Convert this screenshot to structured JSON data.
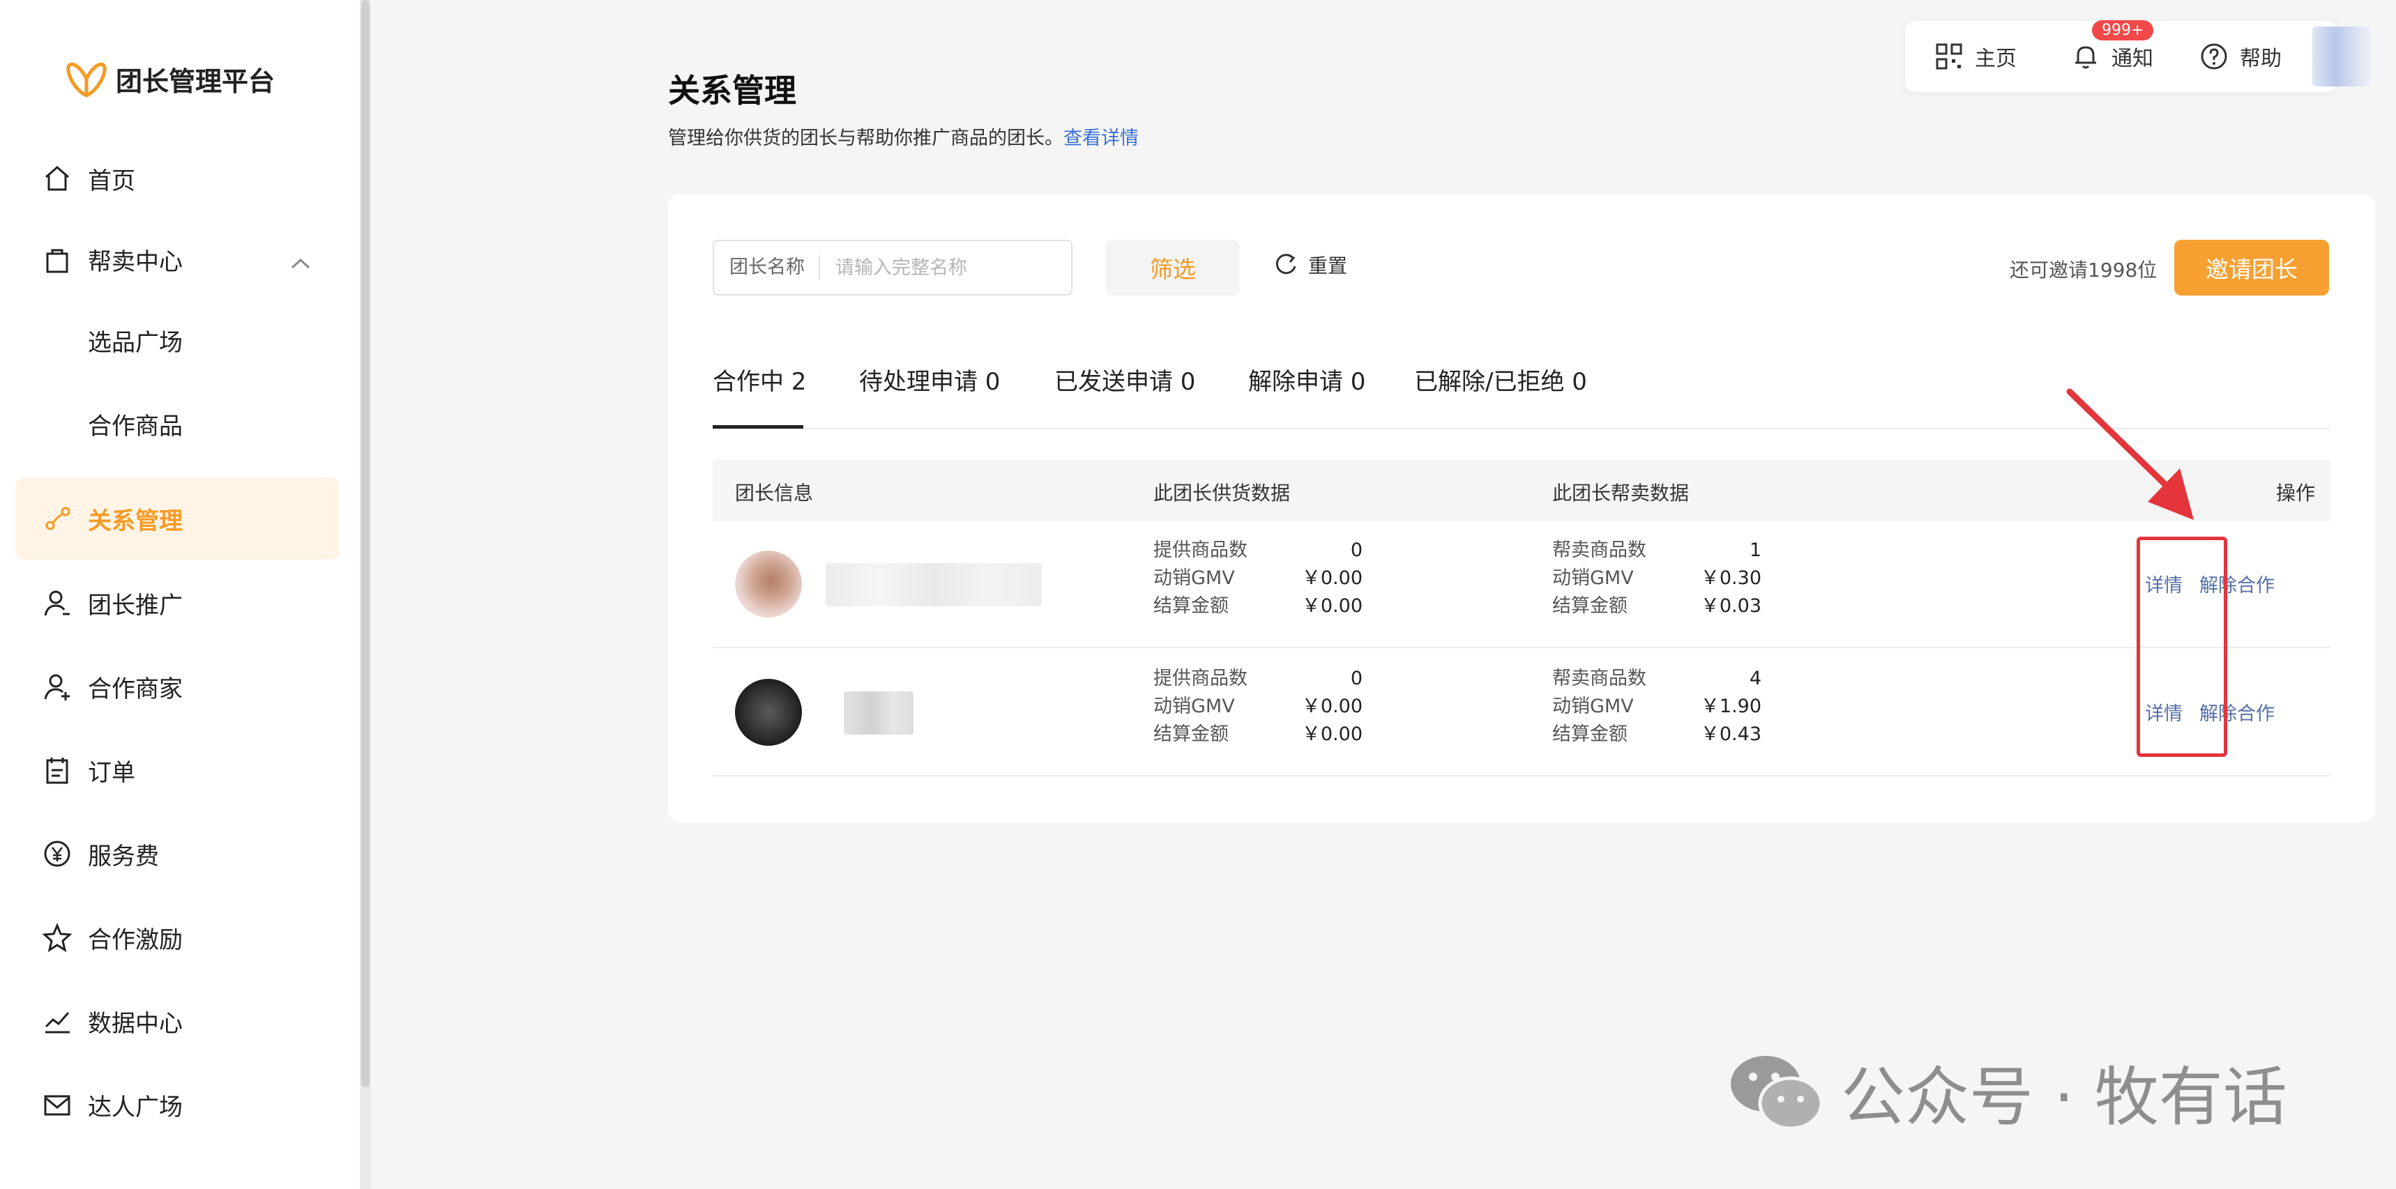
{
  "app": {
    "title": "团长管理平台"
  },
  "sidebar": {
    "items": [
      {
        "label": "首页",
        "icon": "home-icon"
      },
      {
        "label": "帮卖中心",
        "icon": "bag-icon"
      },
      {
        "label": "选品广场"
      },
      {
        "label": "合作商品"
      },
      {
        "label": "关系管理",
        "icon": "relation-icon",
        "active": true
      },
      {
        "label": "团长推广",
        "icon": "promote-icon"
      },
      {
        "label": "合作商家",
        "icon": "merchant-icon"
      },
      {
        "label": "订单",
        "icon": "order-icon"
      },
      {
        "label": "服务费",
        "icon": "yen-icon"
      },
      {
        "label": "合作激励",
        "icon": "star-icon"
      },
      {
        "label": "数据中心",
        "icon": "chart-icon"
      },
      {
        "label": "达人广场",
        "icon": "mail-icon"
      }
    ]
  },
  "topbar": {
    "home": "主页",
    "notify": "通知",
    "notify_badge": "999+",
    "help": "帮助"
  },
  "header": {
    "title": "关系管理",
    "subtitle": "管理给你供货的团长与帮助你推广商品的团长。",
    "detail_link": "查看详情"
  },
  "filter": {
    "label": "团长名称",
    "placeholder": "请输入完整名称",
    "filter_btn": "筛选",
    "reset_btn": "重置",
    "remaining": "还可邀请1998位",
    "invite_btn": "邀请团长"
  },
  "tabs": [
    "合作中 2",
    "待处理申请 0",
    "已发送申请 0",
    "解除申请 0",
    "已解除/已拒绝 0"
  ],
  "table": {
    "headers": [
      "团长信息",
      "此团长供货数据",
      "此团长帮卖数据",
      "操作"
    ],
    "rows": [
      {
        "supply": [
          [
            "提供商品数",
            "0"
          ],
          [
            "动销GMV",
            "￥0.00"
          ],
          [
            "结算金额",
            "￥0.00"
          ]
        ],
        "help": [
          [
            "帮卖商品数",
            "1"
          ],
          [
            "动销GMV",
            "￥0.30"
          ],
          [
            "结算金额",
            "￥0.03"
          ]
        ],
        "ops": [
          "详情",
          "解除合作"
        ]
      },
      {
        "supply": [
          [
            "提供商品数",
            "0"
          ],
          [
            "动销GMV",
            "￥0.00"
          ],
          [
            "结算金额",
            "￥0.00"
          ]
        ],
        "help": [
          [
            "帮卖商品数",
            "4"
          ],
          [
            "动销GMV",
            "￥1.90"
          ],
          [
            "结算金额",
            "￥0.43"
          ]
        ],
        "ops": [
          "详情",
          "解除合作"
        ]
      }
    ]
  },
  "watermark": "公众号 · 牧有话",
  "colors": {
    "accent": "#f59a23",
    "invite": "#f8a031",
    "link": "#3a6fd8",
    "highlight": "#e4343c",
    "badge": "#f04848"
  }
}
